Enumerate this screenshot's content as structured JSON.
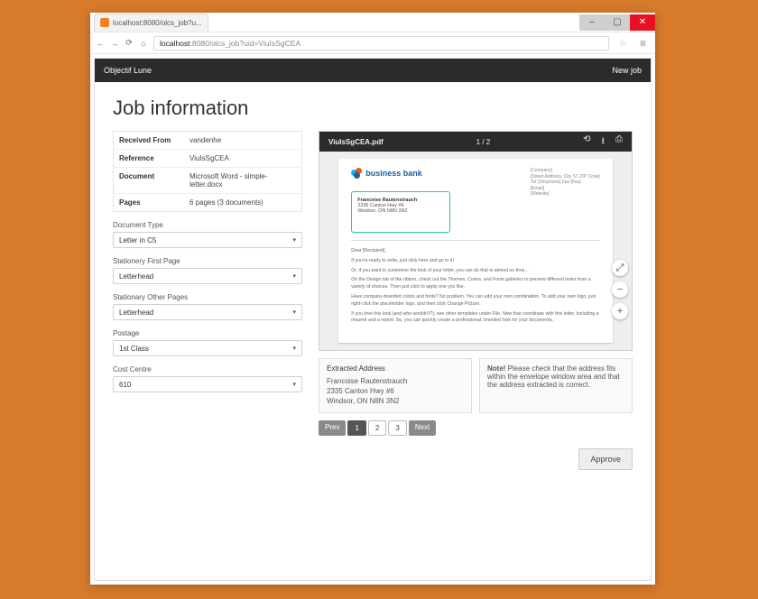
{
  "browser": {
    "tab_title": "localhost:8080/olcs_job?u...",
    "url_host": "localhost",
    "url_port": ":8080",
    "url_path": "/olcs_job?uid=ViuIsSgCEA"
  },
  "brandbar": {
    "title": "Objectif Lune",
    "action": "New job"
  },
  "heading": "Job information",
  "info": {
    "received_from_k": "Received From",
    "received_from_v": "vandenhe",
    "reference_k": "Reference",
    "reference_v": "ViuIsSgCEA",
    "document_k": "Document",
    "document_v": "Microsoft Word - simple-letter.docx",
    "pages_k": "Pages",
    "pages_v": "6 pages (3 documents)"
  },
  "fields": {
    "doc_type_label": "Document Type",
    "doc_type_value": "Letter in C5",
    "first_page_label": "Stationery First Page",
    "first_page_value": "Letterhead",
    "other_pages_label": "Stationary Other Pages",
    "other_pages_value": "Letterhead",
    "postage_label": "Postage",
    "postage_value": "1st Class",
    "cost_centre_label": "Cost Centre",
    "cost_centre_value": "610"
  },
  "pdf": {
    "filename": "ViuIsSgCEA.pdf",
    "page_indicator": "1 / 2",
    "company_name": "business bank",
    "company_addr": "[Company]\n[Street Address, City ST ZIP Code]\nTel [Telephone] Fax [Fax]\n[Email]\n[Website]",
    "env_name": "Francoise Rautenstrauch",
    "env_l1": "2335 Canton Hwy #6",
    "env_l2": "Windsor, ON N8N 3N2",
    "greeting": "Dear [Recipient],",
    "p1": "If you're ready to write, just click here and go to it!",
    "p2": "Or, if you want to customize the look of your letter, you can do that in almost no time...",
    "p3": "On the Design tab of the ribbon, check out the Themes, Colors, and Fonts galleries to preview different looks from a variety of choices. Then just click to apply one you like.",
    "p4": "Have company-branded colors and fonts? No problem. You can add your own combination. To add your own logo, just right-click the placeholder logo, and then click Change Picture.",
    "p5": "If you love this look (and who wouldn't?), see other templates under File, New that coordinate with this letter, including a résumé and a report. So, you can quickly create a professional, branded look for your documents."
  },
  "extracted": {
    "heading": "Extracted Address",
    "l1": "Francoise Rautenstrauch",
    "l2": "2335 Canton Hwy #6",
    "l3": "Windsor, ON N8N 3N2"
  },
  "note": {
    "label": "Note!",
    "text": " Please check that the address fits within the envelope window area and that the address extracted is correct."
  },
  "pager": {
    "prev": "Prev",
    "p1": "1",
    "p2": "2",
    "p3": "3",
    "next": "Next"
  },
  "approve": "Approve"
}
